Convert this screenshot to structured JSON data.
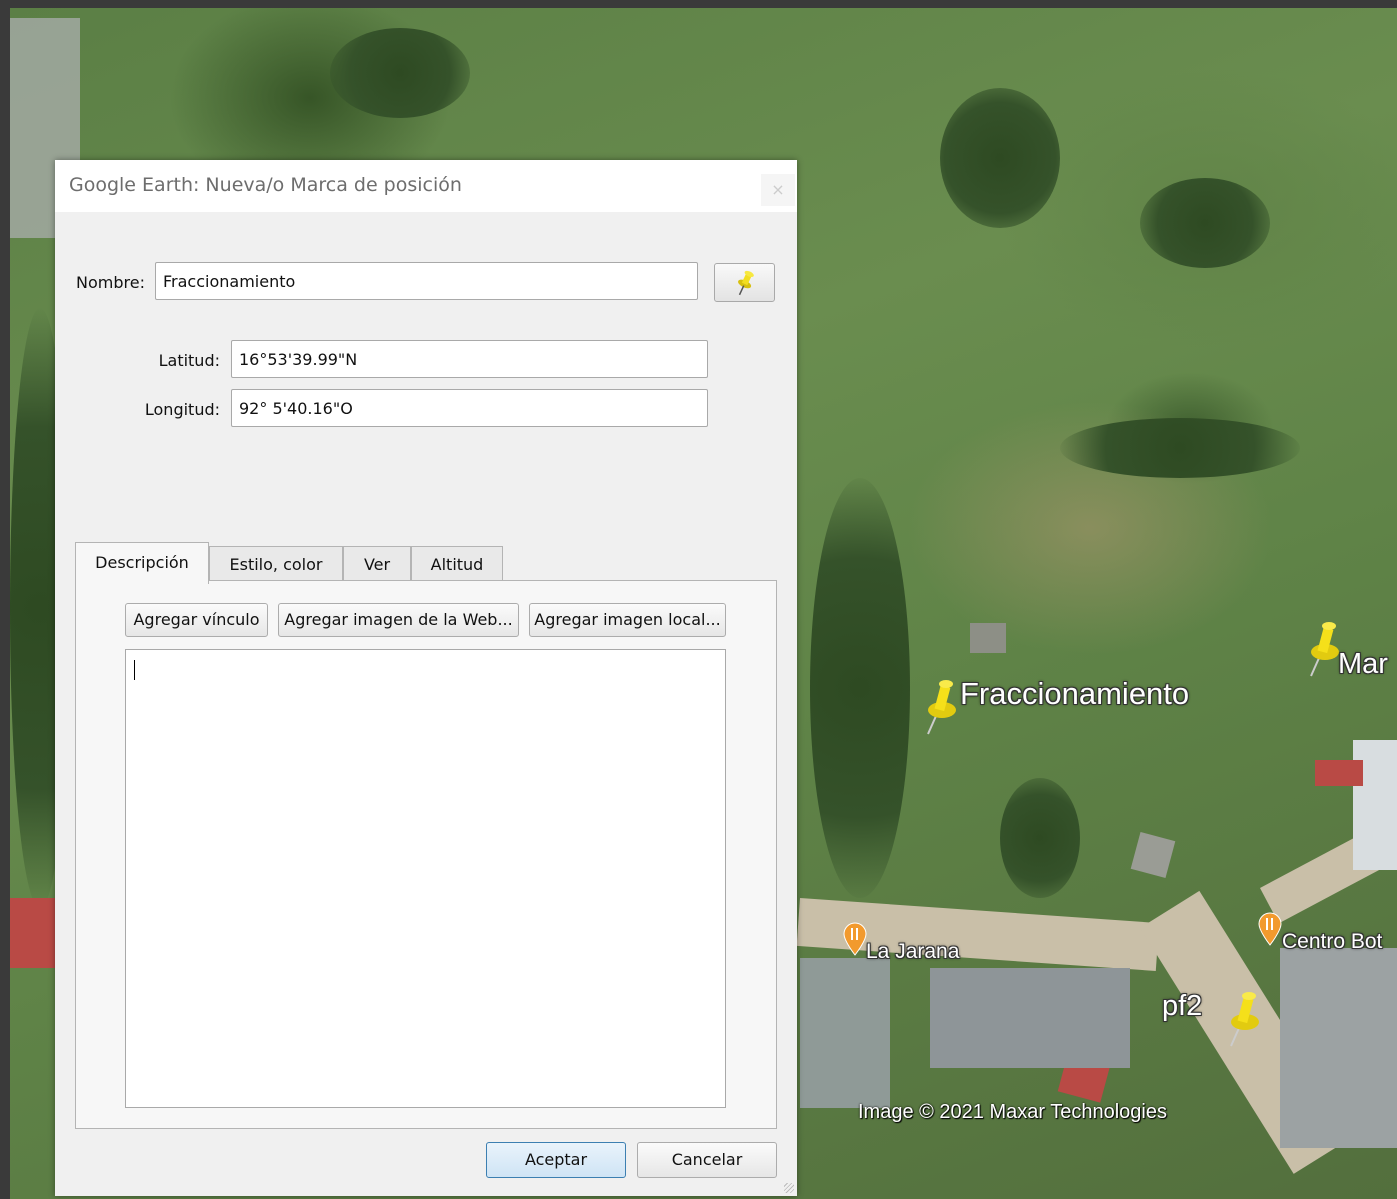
{
  "dialog": {
    "title": "Google Earth: Nueva/o Marca de posición",
    "close_label": "×",
    "name_label": "Nombre:",
    "name_value": "Fraccionamiento",
    "lat_label": "Latitud:",
    "lat_value": "16°53'39.99\"N",
    "lon_label": "Longitud:",
    "lon_value": "92° 5'40.16\"O",
    "tabs": [
      {
        "label": "Descripción",
        "active": true
      },
      {
        "label": "Estilo, color",
        "active": false
      },
      {
        "label": "Ver",
        "active": false
      },
      {
        "label": "Altitud",
        "active": false
      }
    ],
    "description_buttons": {
      "add_link": "Agregar vínculo",
      "add_web_image": "Agregar imagen de la Web...",
      "add_local_image": "Agregar imagen local..."
    },
    "description_text": "",
    "ok_label": "Aceptar",
    "cancel_label": "Cancelar"
  },
  "map": {
    "placemarks": [
      {
        "label": "Fraccionamiento"
      },
      {
        "label": "Mar"
      },
      {
        "label": "pf2"
      }
    ],
    "pois": [
      {
        "label": "La Jarana"
      },
      {
        "label": "Centro Bot"
      }
    ],
    "copyright": "Image © 2021 Maxar Technologies",
    "pin_color": "#f5e01a",
    "poi_color": "#f29a2e"
  }
}
